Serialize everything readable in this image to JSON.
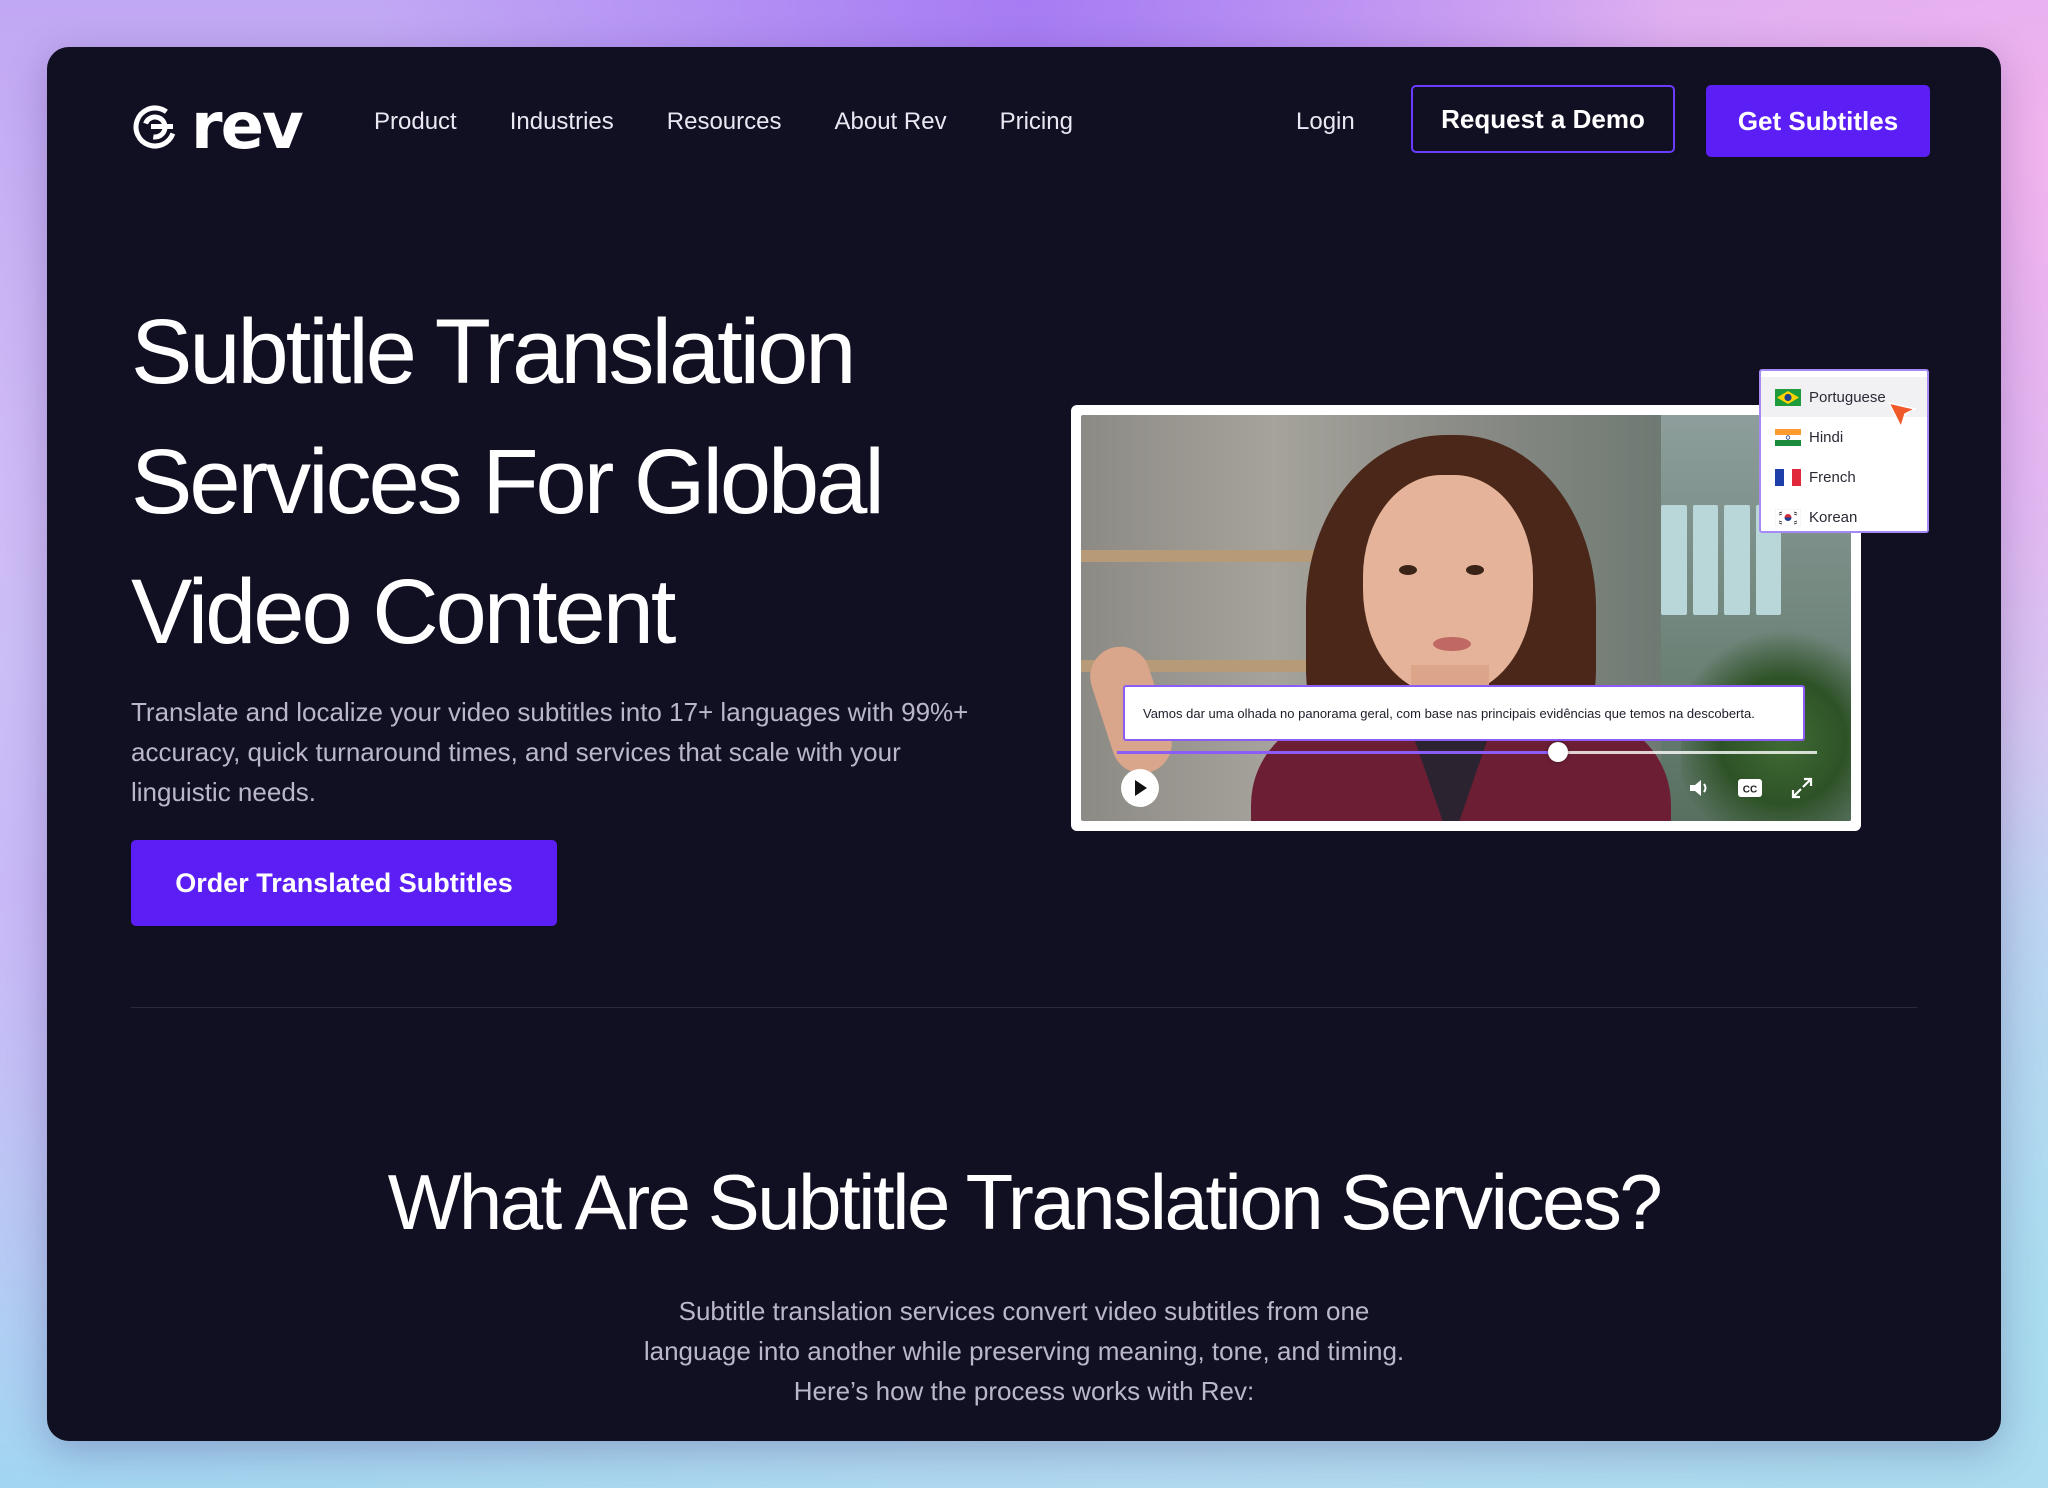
{
  "header": {
    "logo_text": "rev",
    "nav": [
      "Product",
      "Industries",
      "Resources",
      "About Rev",
      "Pricing"
    ],
    "login": "Login",
    "demo_button": "Request a Demo",
    "cta_button": "Get Subtitles"
  },
  "hero": {
    "title_lines": [
      "Subtitle Translation",
      "Services For Global",
      "Video Content"
    ],
    "description": "Translate and localize your video subtitles into 17+ languages with 99%+ accuracy, quick turnaround times, and services that scale with your linguistic needs.",
    "order_button": "Order Translated Subtitles"
  },
  "video": {
    "subtitle": "Vamos dar uma olhada no panorama geral, com base nas principais evidências que temos na descoberta.",
    "progress": 0.63,
    "cc_label": "CC",
    "languages": [
      {
        "name": "Portuguese",
        "flag": "brazil-flag-icon"
      },
      {
        "name": "Hindi",
        "flag": "india-flag-icon"
      },
      {
        "name": "French",
        "flag": "france-flag-icon"
      },
      {
        "name": "Korean",
        "flag": "korea-flag-icon"
      }
    ]
  },
  "section": {
    "title": "What Are Subtitle Translation Services?",
    "description": "Subtitle translation services convert video subtitles from one language into another while preserving meaning, tone, and timing. Here’s how the process works with Rev:"
  },
  "colors": {
    "accent": "#5b1ff5",
    "background": "#110f22",
    "cursor": "#f05a28"
  }
}
